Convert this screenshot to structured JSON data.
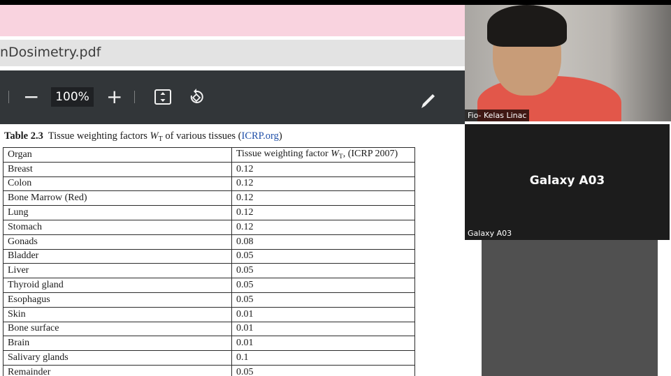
{
  "viewer": {
    "file_name": "nDosimetry.pdf",
    "zoom_out_label": "−",
    "zoom_level": "100%",
    "zoom_in_label": "+",
    "icons": [
      "minus-icon",
      "plus-icon",
      "fit-page-icon",
      "rotate-icon",
      "pen-icon"
    ]
  },
  "document": {
    "caption": {
      "number": "Table 2.3",
      "text_before": "Tissue weighting factors ",
      "symbol": "W",
      "symbol_sub": "T",
      "text_after": " of various tissues (",
      "link": "ICRP.org",
      "close": ")"
    },
    "table": {
      "header_organ": "Organ",
      "header_factor_prefix": "Tissue weighting factor ",
      "header_factor_symbol": "W",
      "header_factor_sub": "T",
      "header_factor_suffix": ", (ICRP 2007)",
      "rows": [
        {
          "organ": "Breast",
          "factor": "0.12"
        },
        {
          "organ": "Colon",
          "factor": "0.12"
        },
        {
          "organ": "Bone Marrow (Red)",
          "factor": "0.12"
        },
        {
          "organ": "Lung",
          "factor": "0.12"
        },
        {
          "organ": "Stomach",
          "factor": "0.12"
        },
        {
          "organ": "Gonads",
          "factor": "0.08"
        },
        {
          "organ": "Bladder",
          "factor": "0.05"
        },
        {
          "organ": "Liver",
          "factor": "0.05"
        },
        {
          "organ": "Thyroid gland",
          "factor": "0.05"
        },
        {
          "organ": "Esophagus",
          "factor": "0.05"
        },
        {
          "organ": "Skin",
          "factor": "0.01"
        },
        {
          "organ": "Bone surface",
          "factor": "0.01"
        },
        {
          "organ": "Brain",
          "factor": "0.01"
        },
        {
          "organ": "Salivary glands",
          "factor": "0.1"
        },
        {
          "organ": "Remainder",
          "factor": "0.05"
        }
      ]
    }
  },
  "participants": {
    "video1": {
      "name": "Fio- Kelas Linac"
    },
    "video2": {
      "title": "Galaxy A03",
      "name": "Galaxy A03"
    }
  },
  "colors": {
    "pink_band": "#f9d3df",
    "toolbar": "#323639",
    "link": "#1f4fa8"
  }
}
